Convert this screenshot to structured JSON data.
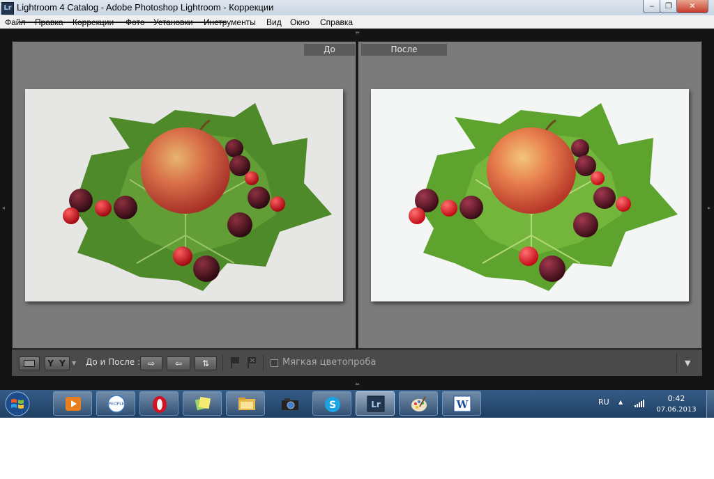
{
  "window": {
    "title": "Lightroom 4 Catalog - Adobe Photoshop Lightroom - Коррекции",
    "app_icon": "Lr",
    "controls": {
      "minimize": "‒",
      "maximize": "❐",
      "close": "✕"
    }
  },
  "menu": {
    "items": [
      "Файл",
      "Правка",
      "Коррекции",
      "Фото",
      "Установки",
      "Инструменты",
      "Вид",
      "Окно",
      "Справка"
    ]
  },
  "compare": {
    "before_label": "До",
    "after_label": "После"
  },
  "toolbar": {
    "view_yy_label": "Y Y",
    "before_after_label": "До и После :",
    "swap_arrow": "⇨",
    "copy_arrow": "⇦",
    "swap_both_arrow": "⇅",
    "softproof_label": "Мягкая цветопроба",
    "softproof_checked": false
  },
  "taskbar": {
    "apps": [
      "media-player",
      "people-net",
      "opera",
      "sticky-notes",
      "file-explorer",
      "camera",
      "skype",
      "lightroom",
      "paint",
      "word"
    ],
    "active_app": "lightroom",
    "people_net_text": "PEOPLE",
    "lightroom_text": "Lr",
    "word_text": "W"
  },
  "tray": {
    "language": "RU",
    "time": "0:42",
    "date": "07.06.2013"
  },
  "colors": {
    "taskbar": "#2a4c75",
    "lr_panel": "#7b7b7b",
    "lr_background": "#141414"
  }
}
